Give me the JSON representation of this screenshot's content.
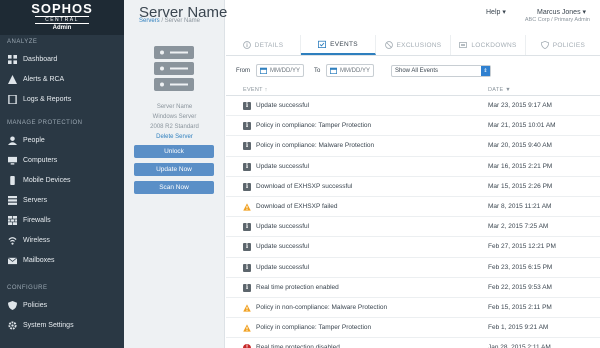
{
  "brand": {
    "name": "SOPHOS",
    "sub": "CENTRAL",
    "role": "Admin"
  },
  "sidebar": {
    "sections": [
      {
        "label": "ANALYZE",
        "items": [
          {
            "label": "Dashboard",
            "icon": "dashboard-icon"
          },
          {
            "label": "Alerts & RCA",
            "icon": "alert-icon"
          },
          {
            "label": "Logs & Reports",
            "icon": "report-icon"
          }
        ]
      },
      {
        "label": "MANAGE PROTECTION",
        "items": [
          {
            "label": "People",
            "icon": "people-icon"
          },
          {
            "label": "Computers",
            "icon": "computer-icon"
          },
          {
            "label": "Mobile Devices",
            "icon": "mobile-icon"
          },
          {
            "label": "Servers",
            "icon": "server-icon"
          },
          {
            "label": "Firewalls",
            "icon": "firewall-icon"
          },
          {
            "label": "Wireless",
            "icon": "wireless-icon"
          },
          {
            "label": "Mailboxes",
            "icon": "mailbox-icon"
          }
        ]
      },
      {
        "label": "CONFIGURE",
        "items": [
          {
            "label": "Policies",
            "icon": "shield-icon"
          },
          {
            "label": "System Settings",
            "icon": "gear-icon"
          }
        ]
      }
    ]
  },
  "header": {
    "title": "Server Name",
    "breadcrumb_link": "Servers",
    "breadcrumb_current": "/ Server Name",
    "help": "Help ▾",
    "user": "Marcus Jones ▾",
    "org": "ABC Corp / Primary Admin"
  },
  "server": {
    "name": "Server Name",
    "os": "Windows Server",
    "version": "2008 R2 Standard",
    "delete_label": "Delete Server",
    "buttons": {
      "unlock": "Unlock",
      "update": "Update Now",
      "scan": "Scan Now"
    }
  },
  "tabs": [
    {
      "label": "DETAILS",
      "icon": "info-icon",
      "active": false
    },
    {
      "label": "EVENTS",
      "icon": "calendar-check-icon",
      "active": true
    },
    {
      "label": "EXCLUSIONS",
      "icon": "block-icon",
      "active": false
    },
    {
      "label": "LOCKDOWNS",
      "icon": "lockdown-icon",
      "active": false
    },
    {
      "label": "POLICIES",
      "icon": "shield-icon",
      "active": false
    }
  ],
  "filters": {
    "from_label": "From",
    "to_label": "To",
    "from_placeholder": "MM/DD/YY",
    "to_placeholder": "MM/DD/YY",
    "select_value": "Show All Events"
  },
  "table": {
    "col_event": "EVENT ↑",
    "col_date": "DATE ▼",
    "rows": [
      {
        "type": "info",
        "event": "Update successful",
        "date": "Mar 23, 2015  9:17 AM"
      },
      {
        "type": "info",
        "event": "Policy in compliance: Tamper Protection",
        "date": "Mar 21, 2015  10:01 AM"
      },
      {
        "type": "info",
        "event": "Policy in compliance: Malware Protection",
        "date": "Mar 20, 2015  9:40 AM"
      },
      {
        "type": "info",
        "event": "Update successful",
        "date": "Mar 16, 2015  2:21 PM"
      },
      {
        "type": "info",
        "event": "Download of EXHSXP successful",
        "date": "Mar 15, 2015  2:26 PM"
      },
      {
        "type": "warning",
        "event": "Download of EXHSXP failed",
        "date": "Mar 8, 2015  11:21 AM"
      },
      {
        "type": "info",
        "event": "Update successful",
        "date": "Mar 2, 2015  7:25 AM"
      },
      {
        "type": "info",
        "event": "Update successful",
        "date": "Feb 27, 2015  12:21 PM"
      },
      {
        "type": "info",
        "event": "Update successful",
        "date": "Feb 23, 2015  6:15 PM"
      },
      {
        "type": "info",
        "event": "Real time protection enabled",
        "date": "Feb 22, 2015  9:53 AM"
      },
      {
        "type": "warning",
        "event": "Policy in non-compliance: Malware Protection",
        "date": "Feb 15, 2015  2:11 PM"
      },
      {
        "type": "warning",
        "event": "Policy in compliance: Tamper Protection",
        "date": "Feb 1, 2015  9:21 AM"
      },
      {
        "type": "error",
        "event": "Real time protection disabled",
        "date": "Jan 28, 2015  2:11 AM"
      }
    ]
  },
  "colors": {
    "sidebar": "#2a3844",
    "accent": "#2e7fbe",
    "button": "#5a8fc7",
    "warning": "#f0a020",
    "error": "#c62828"
  }
}
